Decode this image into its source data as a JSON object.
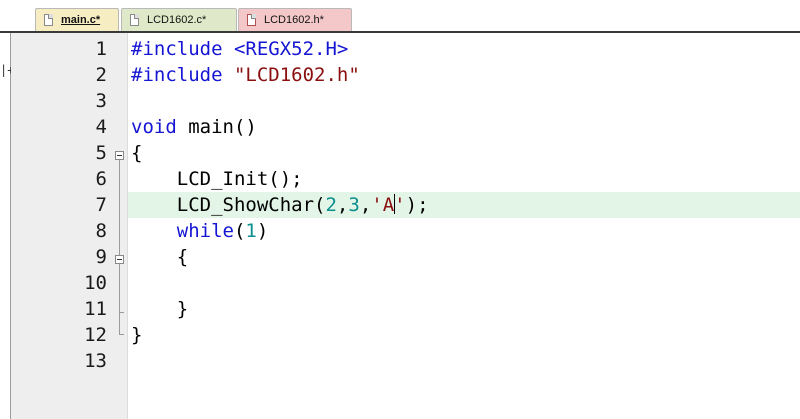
{
  "tabs": [
    {
      "label": "main.c*",
      "active": true,
      "color": "#f7edc2"
    },
    {
      "label": "LCD1602.c*",
      "active": false,
      "color": "#dfe9c9"
    },
    {
      "label": "LCD1602.h*",
      "active": false,
      "color": "#f4c8c8"
    }
  ],
  "editor": {
    "edge_mark": "|+",
    "current_line": 7,
    "lines": [
      {
        "num": "1",
        "parts": [
          {
            "t": "#include <REGX52.H>",
            "c": "kw"
          }
        ]
      },
      {
        "num": "2",
        "parts": [
          {
            "t": "#include ",
            "c": "kw"
          },
          {
            "t": "\"LCD1602.h\"",
            "c": "str"
          }
        ]
      },
      {
        "num": "3",
        "parts": []
      },
      {
        "num": "4",
        "parts": [
          {
            "t": "void",
            "c": "kw"
          },
          {
            "t": " main()",
            "c": "plain"
          }
        ]
      },
      {
        "num": "5",
        "parts": [
          {
            "t": "{",
            "c": "plain"
          }
        ]
      },
      {
        "num": "6",
        "parts": [
          {
            "t": "    LCD_Init();",
            "c": "plain"
          }
        ]
      },
      {
        "num": "7",
        "parts": [
          {
            "t": "    LCD_ShowChar(",
            "c": "plain"
          },
          {
            "t": "2",
            "c": "num"
          },
          {
            "t": ",",
            "c": "plain"
          },
          {
            "t": "3",
            "c": "num"
          },
          {
            "t": ",",
            "c": "plain"
          },
          {
            "t": "'A",
            "c": "str"
          },
          {
            "t": "CARET",
            "c": "caret"
          },
          {
            "t": "'",
            "c": "str"
          },
          {
            "t": ");",
            "c": "plain"
          }
        ]
      },
      {
        "num": "8",
        "parts": [
          {
            "t": "    ",
            "c": "plain"
          },
          {
            "t": "while",
            "c": "kw"
          },
          {
            "t": "(",
            "c": "plain"
          },
          {
            "t": "1",
            "c": "num"
          },
          {
            "t": ")",
            "c": "plain"
          }
        ]
      },
      {
        "num": "9",
        "parts": [
          {
            "t": "    {",
            "c": "plain"
          }
        ]
      },
      {
        "num": "10",
        "parts": []
      },
      {
        "num": "11",
        "parts": [
          {
            "t": "    }",
            "c": "plain"
          }
        ]
      },
      {
        "num": "12",
        "parts": [
          {
            "t": "}",
            "c": "plain"
          }
        ]
      },
      {
        "num": "13",
        "parts": []
      }
    ]
  },
  "colors": {
    "keyword": "#1515d4",
    "string": "#8a1010",
    "number": "#0b8f8f",
    "current_line": "#e3f5e6",
    "gutter": "#eeeeee"
  }
}
